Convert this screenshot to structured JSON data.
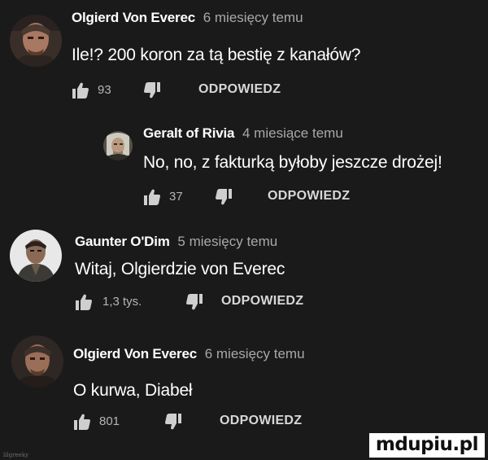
{
  "comments": [
    {
      "author": "Olgierd Von Everec",
      "time": "6 miesięcy temu",
      "text": "Ile!? 200 koron za tą bestię z kanałów?",
      "likes": "93",
      "reply_label": "ODPOWIEDZ",
      "avatar_icon": "olgierd-avatar-icon"
    },
    {
      "author": "Geralt of Rivia",
      "time": "4 miesiące temu",
      "text": "No, no, z fakturką byłoby jeszcze drożej!",
      "likes": "37",
      "reply_label": "ODPOWIEDZ",
      "avatar_icon": "geralt-avatar-icon"
    },
    {
      "author": "Gaunter O'Dim",
      "time": "5 miesięcy temu",
      "text": "Witaj, Olgierdzie von Everec",
      "likes": "1,3 tys.",
      "reply_label": "ODPOWIEDZ",
      "avatar_icon": "gaunter-avatar-icon"
    },
    {
      "author": "Olgierd Von Everec",
      "time": "6 miesięcy temu",
      "text": "O kurwa, Diabeł",
      "likes": "801",
      "reply_label": "ODPOWIEDZ",
      "avatar_icon": "olgierd-avatar-icon"
    }
  ],
  "icons": {
    "like": "thumbs-up-icon",
    "dislike": "thumbs-down-icon"
  },
  "watermark": "mdupiu.pl",
  "corner_tag": "lilgreeky",
  "colors": {
    "background": "#1a1a1a",
    "author": "#ffffff",
    "time": "#a8a8a8",
    "reply": "#d8d8d8"
  }
}
